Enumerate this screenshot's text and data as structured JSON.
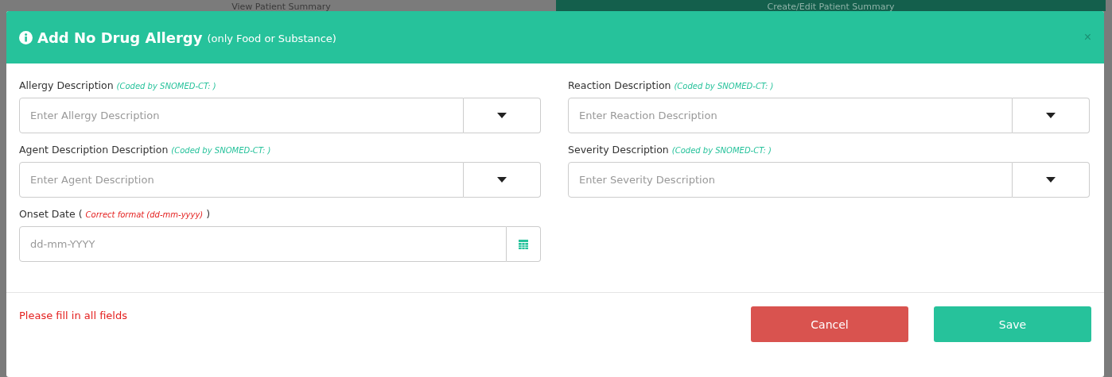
{
  "background_tabs": [
    {
      "label": "View Patient Summary",
      "selected": false
    },
    {
      "label": "Create/Edit Patient Summary",
      "selected": true
    }
  ],
  "modal": {
    "title": "Add No Drug Allergy",
    "subtitle": "(only Food or Substance)",
    "close": "×"
  },
  "fields": [
    {
      "kind": "select",
      "label": "Allergy Description",
      "note": "(Coded by SNOMED-CT: )",
      "color": "#26c29b",
      "placeholder": "Enter Allergy Description"
    },
    {
      "kind": "select",
      "label": "Reaction Description",
      "note": "(Coded by SNOMED-CT: )",
      "color": "#26c29b",
      "placeholder": "Enter Reaction Description"
    },
    {
      "kind": "select",
      "label": "Agent Description Description",
      "note": "(Coded by SNOMED-CT: )",
      "color": "#26c29b",
      "placeholder": "Enter Agent Description"
    },
    {
      "kind": "select",
      "label": "Severity Description",
      "note": "(Coded by SNOMED-CT: )",
      "color": "#26c29b",
      "placeholder": "Enter Severity Description"
    },
    {
      "kind": "date",
      "label": "Onset Date (",
      "note": "Correct format (dd-mm-yyyy)",
      "label_end": ")",
      "color": "#e4201f",
      "placeholder": "dd-mm-YYYY"
    }
  ],
  "footer": {
    "message": "Please fill in all fields",
    "buttons": [
      {
        "label": "Cancel",
        "kind": "danger"
      },
      {
        "label": "Save",
        "kind": "primary"
      }
    ]
  }
}
